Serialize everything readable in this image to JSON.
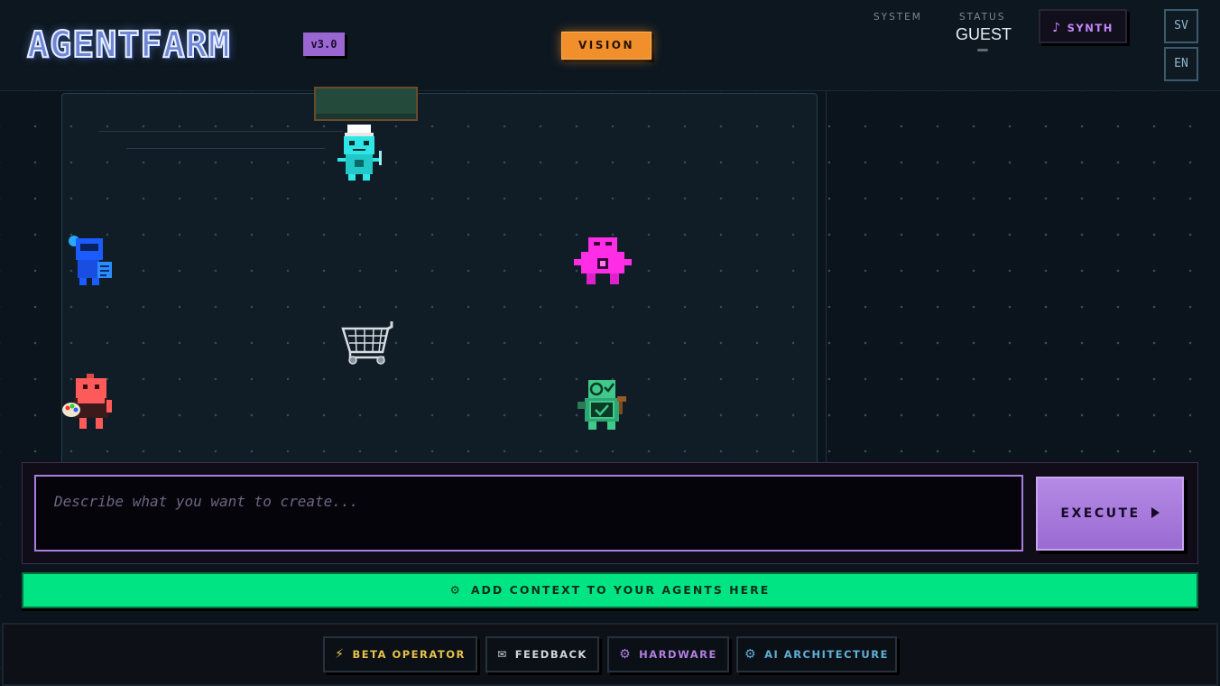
{
  "header": {
    "logo_text": "AGENTFARM",
    "version": "v3.0",
    "vision_label": "VISION",
    "system_label": "SYSTEM",
    "status_label": "STATUS",
    "status_value": "GUEST",
    "synth_label": "SYNTH",
    "synth_icon": "music-note-icon",
    "lang_sv": "SV",
    "lang_en": "EN"
  },
  "field": {
    "agents": [
      {
        "name": "chef-agent",
        "color": "#2ee6e6"
      },
      {
        "name": "writer-agent",
        "color": "#2a6cff"
      },
      {
        "name": "core-agent",
        "color": "#ff2ee6"
      },
      {
        "name": "artist-agent",
        "color": "#ff5a5a"
      },
      {
        "name": "reviewer-agent",
        "color": "#3fc98a"
      }
    ],
    "cart_icon": "shopping-cart-icon"
  },
  "prompt": {
    "placeholder": "Describe what you want to create...",
    "value": ""
  },
  "execute_label": "EXECUTE",
  "context_label": "ADD CONTEXT TO YOUR AGENTS HERE",
  "footer": {
    "buttons": [
      {
        "label": "BETA OPERATOR",
        "icon": "lightning-icon",
        "color": "#e7c14a"
      },
      {
        "label": "FEEDBACK",
        "icon": "envelope-icon",
        "color": "#cfd6de"
      },
      {
        "label": "HARDWARE",
        "icon": "gear-icon",
        "color": "#b07fe0"
      },
      {
        "label": "AI ARCHITECTURE",
        "icon": "gear-icon",
        "color": "#5fb0d6"
      }
    ]
  },
  "colors": {
    "accent_purple": "#a97ee0",
    "accent_orange": "#f08f2c",
    "accent_green": "#00e483",
    "background": "#0b141c"
  }
}
